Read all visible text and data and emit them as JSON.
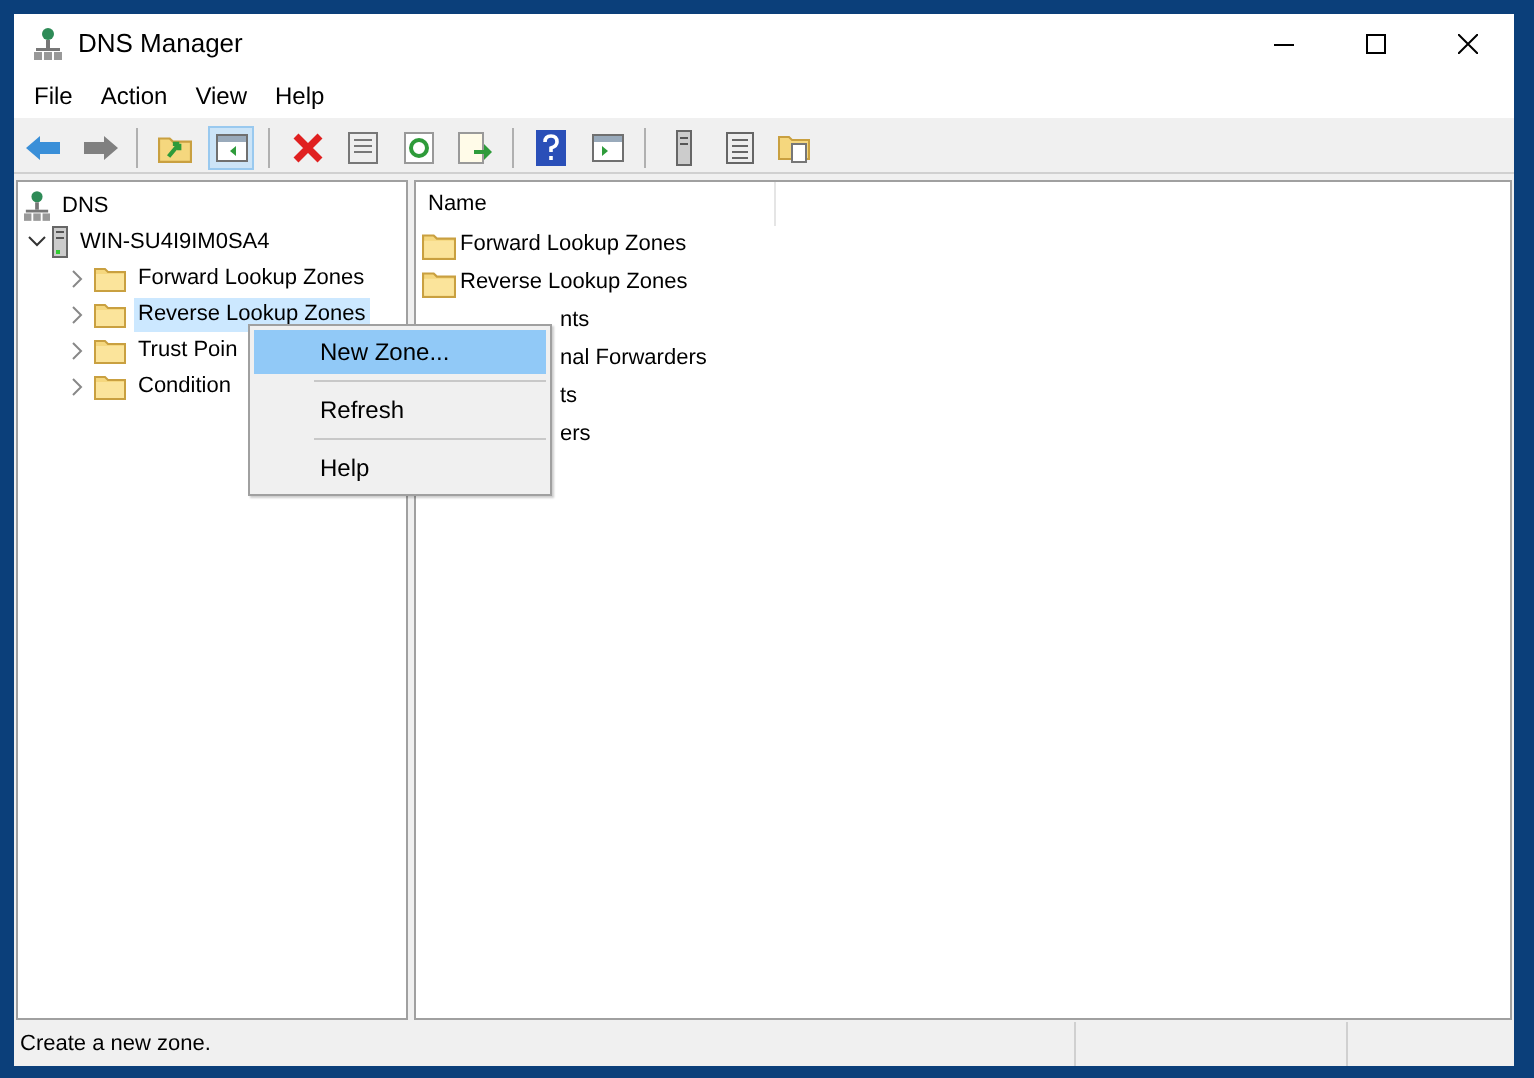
{
  "window": {
    "title": "DNS Manager"
  },
  "menu_bar": [
    "File",
    "Action",
    "View",
    "Help"
  ],
  "toolbar": {
    "console_tree_pressed": true
  },
  "tree": [
    {
      "label": "DNS",
      "kind": "root",
      "children": [
        {
          "label": "WIN-SU4I9IM0SA4",
          "kind": "server",
          "expanded": true,
          "selected": false,
          "children": [
            {
              "label": "Forward Lookup Zones",
              "kind": "folder",
              "expanded": false,
              "selected": false
            },
            {
              "label": "Reverse Lookup Zones",
              "kind": "folder",
              "expanded": false,
              "selected": true
            },
            {
              "label": "Trust Poin",
              "kind": "folder",
              "expanded": false,
              "selected": false
            },
            {
              "label": "Condition",
              "kind": "folder",
              "expanded": false,
              "selected": false
            }
          ]
        }
      ]
    }
  ],
  "list": {
    "columns": [
      "Name"
    ],
    "rows": [
      {
        "name": "Forward Lookup Zones",
        "kind": "folder"
      },
      {
        "name": "Reverse Lookup Zones",
        "kind": "folder"
      },
      {
        "name": "nts",
        "kind": "covered"
      },
      {
        "name": "nal Forwarders",
        "kind": "covered"
      },
      {
        "name": "ts",
        "kind": "covered"
      },
      {
        "name": "ers",
        "kind": "covered"
      }
    ]
  },
  "context_menu": [
    {
      "kind": "item",
      "label": "New Zone...",
      "selected": true
    },
    {
      "kind": "separator"
    },
    {
      "kind": "item",
      "label": "Refresh",
      "selected": false
    },
    {
      "kind": "separator"
    },
    {
      "kind": "item",
      "label": "Help",
      "selected": false
    }
  ],
  "status_bar": "Create a new zone."
}
